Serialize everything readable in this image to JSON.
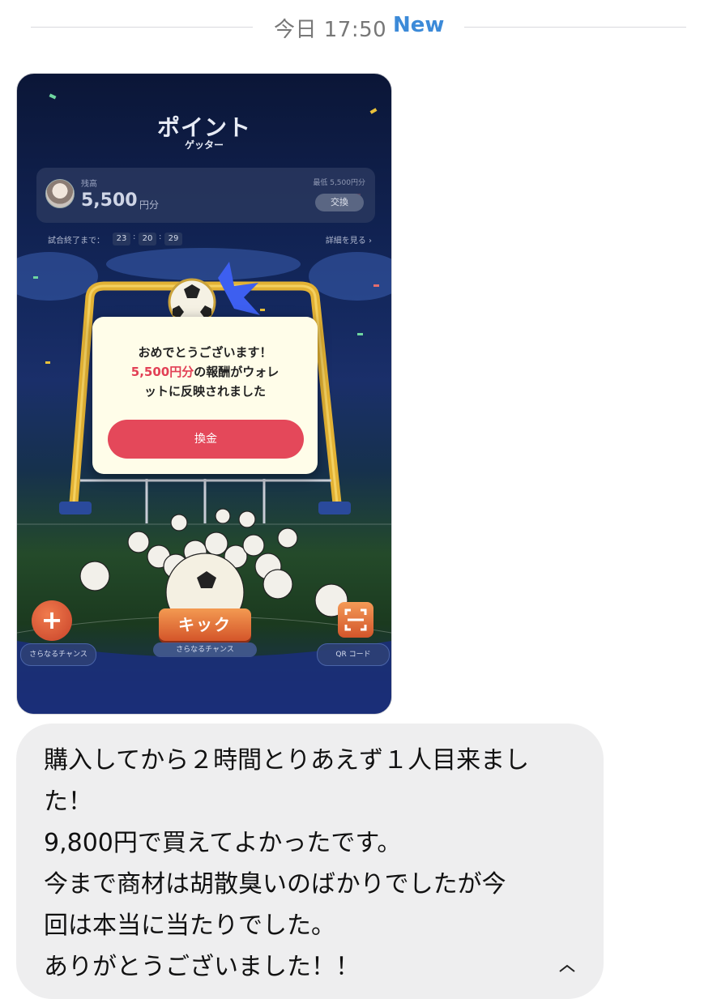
{
  "date_divider": {
    "label": "今日 17:50",
    "badge": "New"
  },
  "screenshot": {
    "app_title": "ポイント",
    "app_subtitle": "ゲッター",
    "balance": {
      "label": "残高",
      "amount": "5,500",
      "unit": "円分",
      "minimum": "最低 5,500円分",
      "exchange_button": "交換"
    },
    "timer": {
      "label": "試合終了まで：",
      "hours": "23",
      "minutes": "20",
      "seconds": "29",
      "details_link": "詳細を見る ›"
    },
    "popup": {
      "line1": "おめでとうございます！",
      "highlight": "5,500円分",
      "line2_rest": "の報酬がウォレ",
      "line3": "ットに反映されました",
      "button": "換金"
    },
    "kick_button": "キック",
    "kick_sub_label": "さらなるチャンス",
    "plus_icon_glyph": "+",
    "plus_label": "さらなるチャンス",
    "qr_label": "QR コード",
    "colors": {
      "accent_red": "#e4485a",
      "highlight_red": "#e24055",
      "orange": "#e2703a"
    }
  },
  "message": {
    "lines": [
      "購入してから２時間とりあえず１人目来まし",
      "た！",
      "9,800円で買えてよかったです。",
      "今まで商材は胡散臭いのばかりでしたが今",
      "回は本当に当たりでした。",
      "ありがとうございました！！"
    ]
  }
}
